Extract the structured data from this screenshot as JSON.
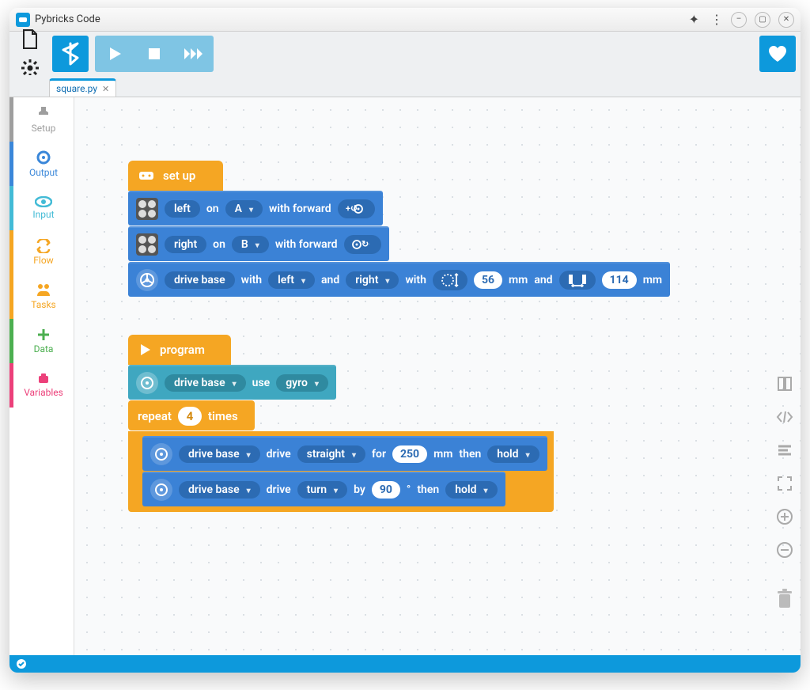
{
  "window": {
    "title": "Pybricks Code"
  },
  "tabs": {
    "active": "square.py"
  },
  "categories": {
    "setup": "Setup",
    "output": "Output",
    "input": "Input",
    "flow": "Flow",
    "tasks": "Tasks",
    "data": "Data",
    "variables": "Variables"
  },
  "setup_stack": {
    "hat": "set up",
    "motor_left": {
      "label": "left",
      "on": "on",
      "port": "A",
      "with_fwd": "with forward"
    },
    "motor_right": {
      "label": "right",
      "on": "on",
      "port": "B",
      "with_fwd": "with forward"
    },
    "drivebase": {
      "label": "drive base",
      "with1": "with",
      "left": "left",
      "and1": "and",
      "right": "right",
      "with2": "with",
      "wheel_diam": "56",
      "mm1": "mm",
      "and2": "and",
      "axle": "114",
      "mm2": "mm"
    }
  },
  "program_stack": {
    "hat": "program",
    "usegyro": {
      "target": "drive base",
      "use": "use",
      "mode": "gyro"
    },
    "repeat": {
      "label_repeat": "repeat",
      "count": "4",
      "label_times": "times"
    },
    "straight": {
      "target": "drive base",
      "drive": "drive",
      "mode": "straight",
      "for": "for",
      "dist": "250",
      "mm": "mm",
      "then": "then",
      "stop": "hold"
    },
    "turn": {
      "target": "drive base",
      "drive": "drive",
      "mode": "turn",
      "by": "by",
      "angle": "90",
      "deg": "°",
      "then": "then",
      "stop": "hold"
    }
  }
}
